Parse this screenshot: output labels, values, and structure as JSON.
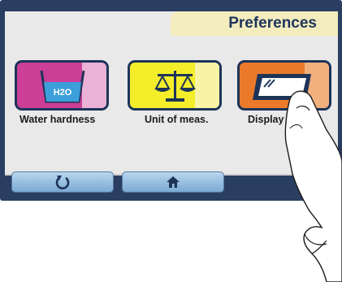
{
  "header": {
    "title": "Preferences"
  },
  "tiles": [
    {
      "label": "Water hardness",
      "icon": "water-glass-icon",
      "icon_text": "H2O",
      "color": "#cb3f97"
    },
    {
      "label": "Unit of meas.",
      "icon": "scale-icon",
      "color": "#f4ee2a"
    },
    {
      "label": "Display",
      "icon": "display-screen-icon",
      "color": "#ea7a2a"
    }
  ],
  "nav": {
    "back_icon": "undo-arrow-icon",
    "home_icon": "home-icon"
  },
  "colors": {
    "frame": "#2a3e62",
    "title_tab": "#f3ecbd",
    "nav_button": "#9cc3e6"
  }
}
